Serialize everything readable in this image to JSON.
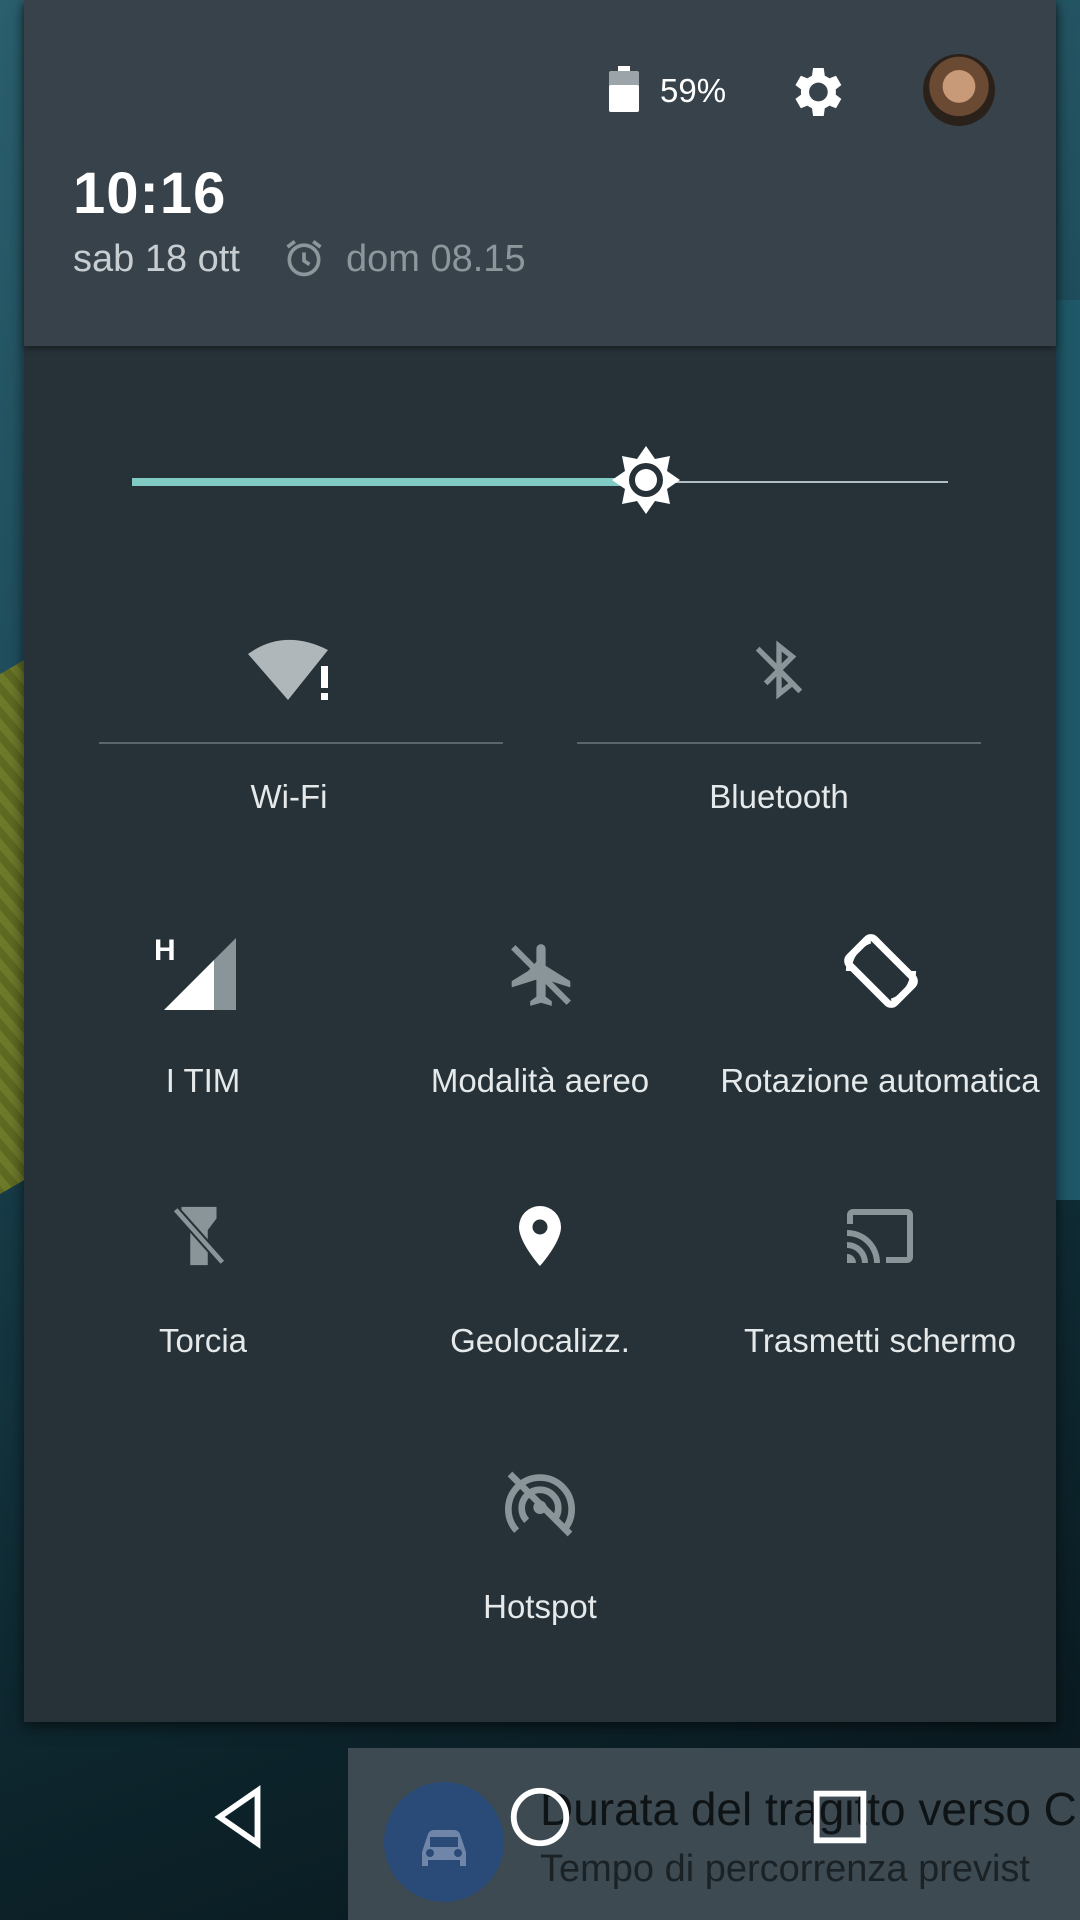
{
  "header": {
    "battery_percent": "59%",
    "time": "10:16",
    "date": "sab 18 ott",
    "alarm": "dom 08.15"
  },
  "brightness": {
    "level": 0.63
  },
  "tiles_row1": [
    {
      "label": "Wi-Fi",
      "icon": "wifi-alert-icon"
    },
    {
      "label": "Bluetooth",
      "icon": "bluetooth-off-icon"
    }
  ],
  "tiles_grid": [
    {
      "label": "I TIM",
      "icon": "cell-signal-h-icon"
    },
    {
      "label": "Modalità aereo",
      "icon": "airplane-off-icon"
    },
    {
      "label": "Rotazione automatica",
      "icon": "auto-rotate-icon"
    },
    {
      "label": "Torcia",
      "icon": "flashlight-off-icon"
    },
    {
      "label": "Geolocalizz.",
      "icon": "location-icon"
    },
    {
      "label": "Trasmetti schermo",
      "icon": "cast-icon"
    },
    {
      "label": "Hotspot",
      "icon": "hotspot-off-icon"
    }
  ],
  "notification": {
    "title": "Durata del tragitto verso C",
    "text": "Tempo di percorrenza previst"
  },
  "colors": {
    "accent": "#80cbc4",
    "panel": "#263238",
    "header": "#37424a"
  }
}
